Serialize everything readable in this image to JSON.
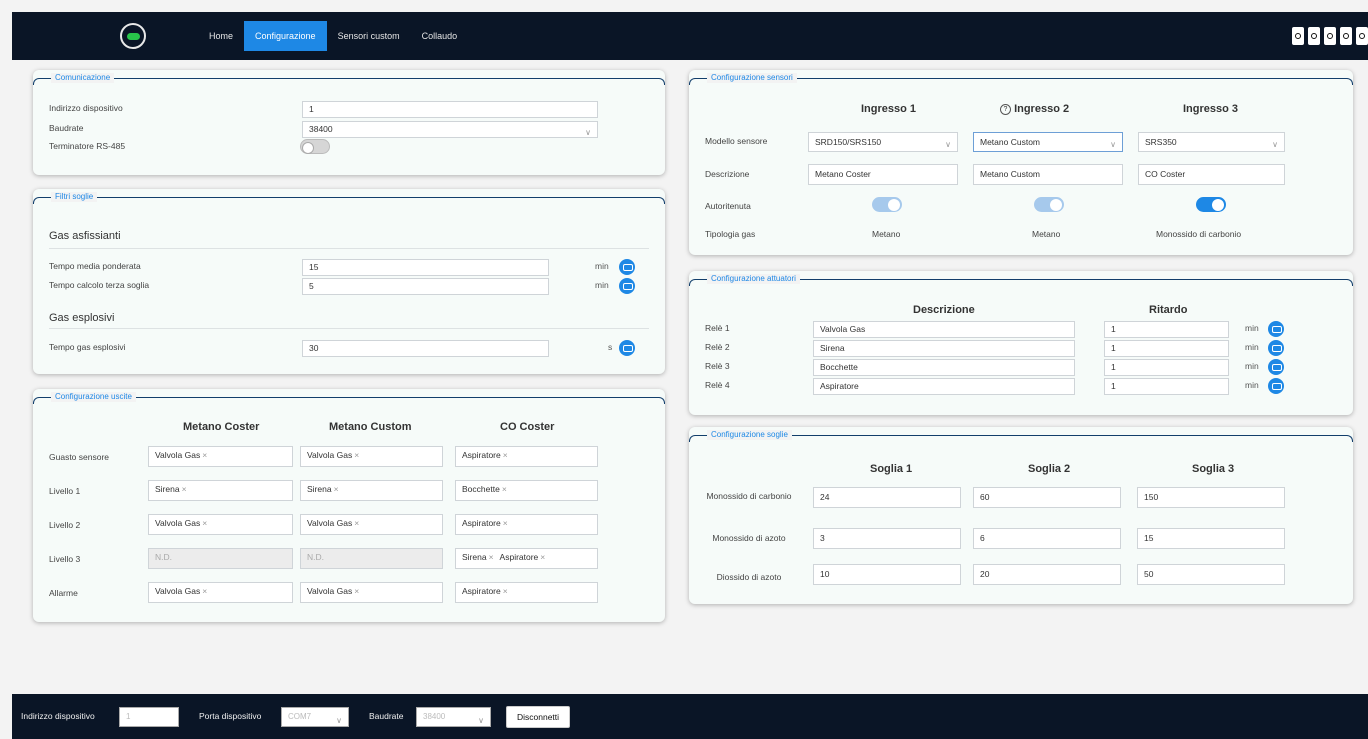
{
  "nav": {
    "items": [
      "Home",
      "Configurazione",
      "Sensori custom",
      "Collaudo"
    ],
    "active": "Configurazione"
  },
  "comunicazione": {
    "title": "Comunicazione",
    "address_label": "Indirizzo dispositivo",
    "address_value": "1",
    "baudrate_label": "Baudrate",
    "baudrate_value": "38400",
    "terminator_label": "Terminatore RS-485",
    "terminator_on": false
  },
  "filtri": {
    "title": "Filtri soglie",
    "asfissianti_title": "Gas asfissianti",
    "media_label": "Tempo media ponderata",
    "media_value": "15",
    "media_unit": "min",
    "terza_label": "Tempo calcolo terza soglia",
    "terza_value": "5",
    "terza_unit": "min",
    "esplosivi_title": "Gas esplosivi",
    "esplosivi_label": "Tempo gas esplosivi",
    "esplosivi_value": "30",
    "esplosivi_unit": "s"
  },
  "uscite": {
    "title": "Configurazione uscite",
    "columns": [
      "Metano Coster",
      "Metano Custom",
      "CO Coster"
    ],
    "rows": [
      {
        "label": "Guasto sensore",
        "cells": [
          [
            "Valvola Gas"
          ],
          [
            "Valvola Gas"
          ],
          [
            "Aspiratore"
          ]
        ]
      },
      {
        "label": "Livello 1",
        "cells": [
          [
            "Sirena"
          ],
          [
            "Sirena"
          ],
          [
            "Bocchette"
          ]
        ]
      },
      {
        "label": "Livello 2",
        "cells": [
          [
            "Valvola Gas"
          ],
          [
            "Valvola Gas"
          ],
          [
            "Aspiratore"
          ]
        ]
      },
      {
        "label": "Livello 3",
        "cells": [
          "N.D.",
          "N.D.",
          [
            "Sirena",
            "Aspiratore"
          ]
        ]
      },
      {
        "label": "Allarme",
        "cells": [
          [
            "Valvola Gas"
          ],
          [
            "Valvola Gas"
          ],
          [
            "Aspiratore"
          ]
        ]
      }
    ],
    "remove_glyph": "×"
  },
  "sensori": {
    "title": "Configurazione sensori",
    "columns": [
      "Ingresso 1",
      "Ingresso 2",
      "Ingresso 3"
    ],
    "help_glyph": "?",
    "modello_label": "Modello sensore",
    "modelli": [
      "SRD150/SRS150",
      "Metano Custom",
      "SRS350"
    ],
    "descrizione_label": "Descrizione",
    "descrizioni": [
      "Metano Coster",
      "Metano Custom",
      "CO Coster"
    ],
    "autoritenuta_label": "Autoritenuta",
    "autoritenuta": [
      "on-dim",
      "on-dim",
      "on"
    ],
    "tipologia_label": "Tipologia gas",
    "tipologie": [
      "Metano",
      "Metano",
      "Monossido di carbonio"
    ]
  },
  "attuatori": {
    "title": "Configurazione attuatori",
    "col_descrizione": "Descrizione",
    "col_ritardo": "Ritardo",
    "unit": "min",
    "rows": [
      {
        "label": "Relè 1",
        "descrizione": "Valvola Gas",
        "ritardo": "1"
      },
      {
        "label": "Relè 2",
        "descrizione": "Sirena",
        "ritardo": "1"
      },
      {
        "label": "Relè 3",
        "descrizione": "Bocchette",
        "ritardo": "1"
      },
      {
        "label": "Relè 4",
        "descrizione": "Aspiratore",
        "ritardo": "1"
      }
    ]
  },
  "soglie": {
    "title": "Configurazione soglie",
    "columns": [
      "Soglia 1",
      "Soglia 2",
      "Soglia 3"
    ],
    "rows": [
      {
        "label": "Monossido di carbonio",
        "values": [
          "24",
          "60",
          "150"
        ]
      },
      {
        "label": "Monossido di azoto",
        "values": [
          "3",
          "6",
          "15"
        ]
      },
      {
        "label": "Diossido di azoto",
        "values": [
          "10",
          "20",
          "50"
        ]
      }
    ]
  },
  "bottom": {
    "address_label": "Indirizzo dispositivo",
    "address_value": "1",
    "port_label": "Porta dispositivo",
    "port_value": "COM7",
    "baud_label": "Baudrate",
    "baud_value": "38400",
    "disconnect": "Disconnetti"
  },
  "colors": {
    "accent": "#1e88e5",
    "bar": "#0a1526",
    "panel_border": "#123e6b"
  }
}
